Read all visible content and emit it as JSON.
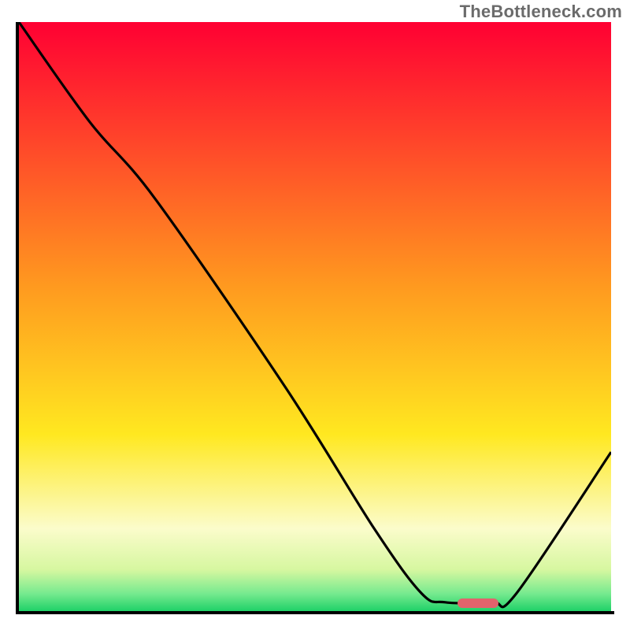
{
  "watermark": {
    "text": "TheBottleneck.com"
  },
  "chart_data": {
    "type": "line",
    "title": "",
    "xlabel": "",
    "ylabel": "",
    "x_range_norm": [
      0,
      1
    ],
    "y_range_norm": [
      0,
      1
    ],
    "note": "Axes are unlabeled; values below are normalized 0-1 estimates read from the image (y = 0 at bottom).",
    "series": [
      {
        "name": "bottleneck-curve",
        "points_norm": [
          {
            "x": 0.0,
            "y": 1.0
          },
          {
            "x": 0.12,
            "y": 0.83
          },
          {
            "x": 0.23,
            "y": 0.7
          },
          {
            "x": 0.45,
            "y": 0.38
          },
          {
            "x": 0.6,
            "y": 0.14
          },
          {
            "x": 0.68,
            "y": 0.03
          },
          {
            "x": 0.72,
            "y": 0.015
          },
          {
            "x": 0.8,
            "y": 0.015
          },
          {
            "x": 0.84,
            "y": 0.03
          },
          {
            "x": 1.0,
            "y": 0.27
          }
        ]
      }
    ],
    "marker": {
      "name": "optimal-range",
      "x_norm": [
        0.74,
        0.81
      ],
      "y_norm": 0.013,
      "color": "#e2636c"
    },
    "background_gradient_stops": [
      {
        "offset": 0.0,
        "color": "#ff0033"
      },
      {
        "offset": 0.45,
        "color": "#ff9a1f"
      },
      {
        "offset": 0.7,
        "color": "#ffe820"
      },
      {
        "offset": 0.86,
        "color": "#fbfccb"
      },
      {
        "offset": 0.93,
        "color": "#d6f7a0"
      },
      {
        "offset": 0.97,
        "color": "#77ea8f"
      },
      {
        "offset": 1.0,
        "color": "#1fd168"
      }
    ]
  }
}
